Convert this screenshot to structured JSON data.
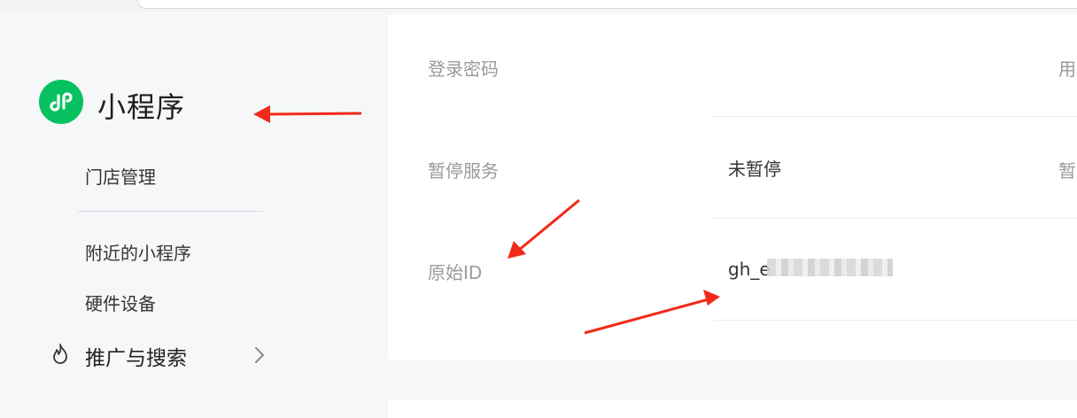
{
  "sidebar": {
    "brand": {
      "title": "小程序",
      "icon": "miniprogram-icon",
      "color": "#07c160"
    },
    "items": [
      {
        "label": "门店管理"
      },
      {
        "label": "附近的小程序"
      },
      {
        "label": "硬件设备"
      }
    ],
    "promo": {
      "label": "推广与搜索",
      "icon": "fire-icon",
      "chevron": "chevron-right-icon"
    }
  },
  "settings": {
    "rows": [
      {
        "label": "登录密码",
        "value": "",
        "right": "用"
      },
      {
        "label": "暂停服务",
        "value": "未暂停",
        "right": "暂"
      },
      {
        "label": "原始ID",
        "value": "gh_e",
        "right": ""
      }
    ]
  },
  "annotation_color": "#f12a1a"
}
